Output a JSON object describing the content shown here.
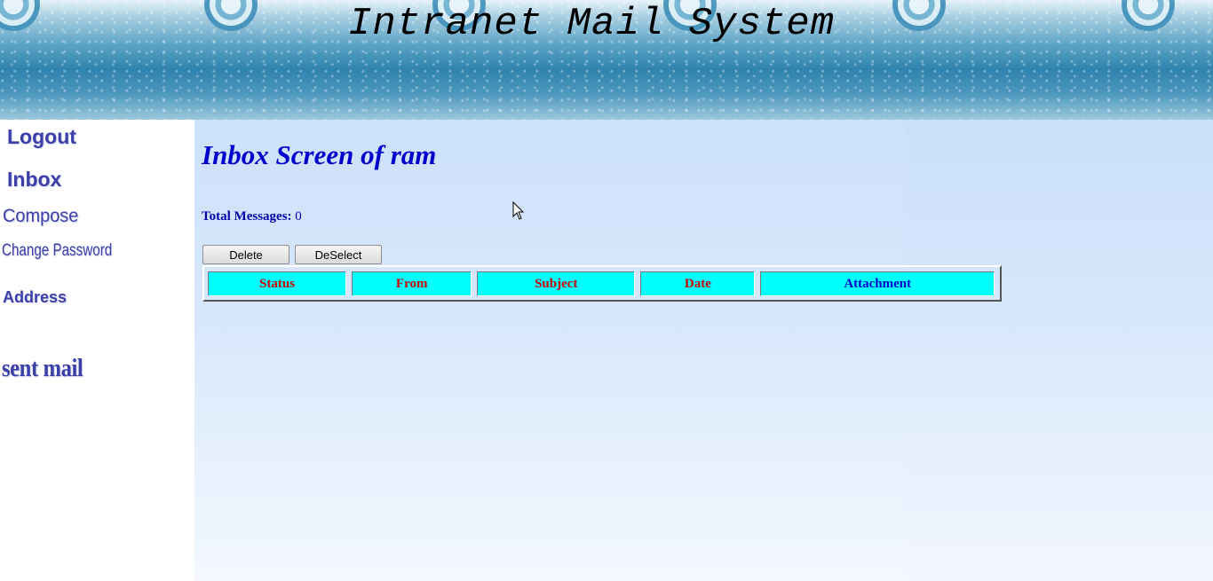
{
  "header": {
    "title": "Intranet Mail System"
  },
  "sidebar": {
    "items": [
      {
        "label": "Logout"
      },
      {
        "label": "Inbox"
      },
      {
        "label": "Compose"
      },
      {
        "label": "Change Password"
      },
      {
        "label": "Address"
      },
      {
        "label": "sent mail"
      }
    ]
  },
  "main": {
    "heading": "Inbox Screen of ram",
    "total_messages_label": "Total Messages:",
    "total_messages_value": "0",
    "buttons": {
      "delete": "Delete",
      "deselect": "DeSelect"
    },
    "table": {
      "columns": [
        {
          "label": "Status",
          "color": "#cc0000"
        },
        {
          "label": "From",
          "color": "#cc0000"
        },
        {
          "label": "Subject",
          "color": "#cc0000"
        },
        {
          "label": "Date",
          "color": "#cc0000"
        },
        {
          "label": "Attachment",
          "color": "#0000cc"
        }
      ],
      "header_background": "#00ffff"
    }
  },
  "colors": {
    "nav": "#3b3fa8",
    "heading": "#0000cc"
  }
}
